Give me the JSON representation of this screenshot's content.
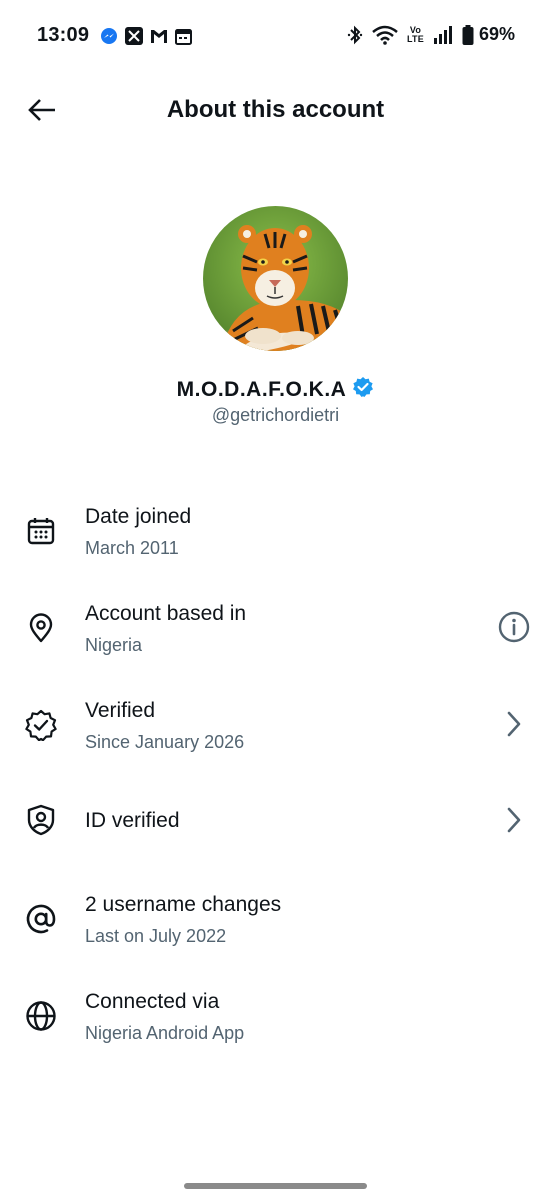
{
  "status_bar": {
    "time": "13:09",
    "notification_icons": [
      "messenger-icon",
      "x-icon",
      "gmail-icon",
      "calendar-icon"
    ],
    "system_icons": [
      "bluetooth-icon",
      "wifi-icon",
      "volte-icon",
      "signal-icon",
      "battery-icon"
    ],
    "volte_top": "Vo",
    "volte_bottom": "LTE",
    "battery": "69%"
  },
  "header": {
    "title": "About this account"
  },
  "profile": {
    "display_name": "M.O.D.A.F.O.K.A",
    "handle": "@getrichordietri",
    "verified_badge_color": "#1d9bf0"
  },
  "info_rows": [
    {
      "icon": "calendar-icon",
      "title": "Date joined",
      "subtitle": "March 2011",
      "action": ""
    },
    {
      "icon": "location-pin-icon",
      "title": "Account based in",
      "subtitle": "Nigeria",
      "action": "info-icon"
    },
    {
      "icon": "verified-badge-icon",
      "title": "Verified",
      "subtitle": "Since January 2026",
      "action": "chevron-right-icon"
    },
    {
      "icon": "id-shield-icon",
      "title": "ID verified",
      "subtitle": "",
      "action": "chevron-right-icon"
    },
    {
      "icon": "at-sign-icon",
      "title": "2 username changes",
      "subtitle": "Last on July 2022",
      "action": ""
    },
    {
      "icon": "globe-icon",
      "title": "Connected via",
      "subtitle": "Nigeria Android App",
      "action": ""
    }
  ],
  "colors": {
    "text_primary": "#0f1419",
    "text_secondary": "#536471",
    "accent": "#1d9bf0"
  }
}
